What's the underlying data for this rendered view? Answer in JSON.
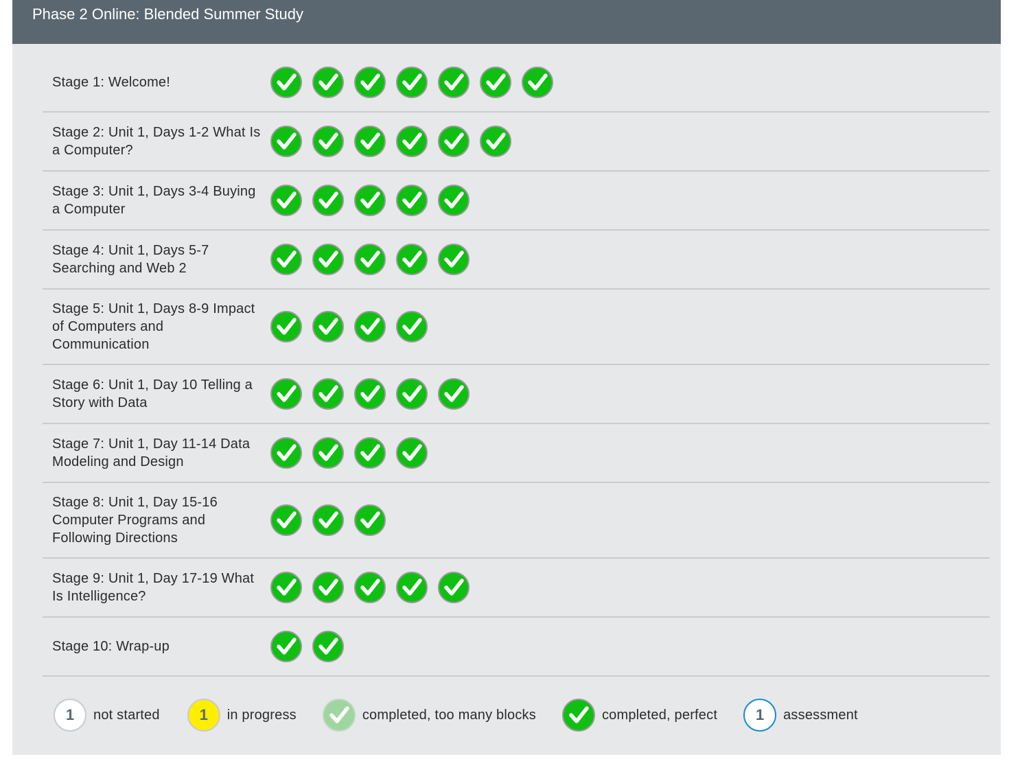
{
  "header": {
    "title": "Phase 2 Online: Blended Summer Study"
  },
  "stages": [
    {
      "name": "Stage 1: Welcome!",
      "levels": 7
    },
    {
      "name": "Stage 2: Unit 1, Days 1-2 What Is a Computer?",
      "levels": 6
    },
    {
      "name": "Stage 3: Unit 1, Days 3-4 Buying a Computer",
      "levels": 5
    },
    {
      "name": "Stage 4: Unit 1, Days 5-7 Searching and Web 2",
      "levels": 5
    },
    {
      "name": "Stage 5: Unit 1, Days 8-9 Impact of Computers and Communication",
      "levels": 4
    },
    {
      "name": "Stage 6: Unit 1, Day 10 Telling a Story with Data",
      "levels": 5
    },
    {
      "name": "Stage 7: Unit 1, Day 11-14 Data Modeling and Design",
      "levels": 4
    },
    {
      "name": "Stage 8: Unit 1, Day 15-16 Computer Programs and Following Directions",
      "levels": 3
    },
    {
      "name": "Stage 9: Unit 1, Day 17-19 What Is Intelligence?",
      "levels": 5
    },
    {
      "name": "Stage 10: Wrap-up",
      "levels": 2
    }
  ],
  "level_status": "completed-perfect",
  "legend": {
    "not_started": {
      "number": "1",
      "label": "not started"
    },
    "in_progress": {
      "number": "1",
      "label": "in progress"
    },
    "too_many_blocks": {
      "label": "completed, too many blocks"
    },
    "perfect": {
      "label": "completed, perfect"
    },
    "assessment": {
      "number": "1",
      "label": "assessment"
    }
  },
  "colors": {
    "header_bg": "#5b6770",
    "perfect_green": "#0fbf12",
    "too_many_green": "#9fd6a0",
    "in_progress_yellow": "#ffee00",
    "assessment_blue": "#1a8fc9"
  },
  "icons": {
    "level_bubble": "checkmark-icon"
  }
}
